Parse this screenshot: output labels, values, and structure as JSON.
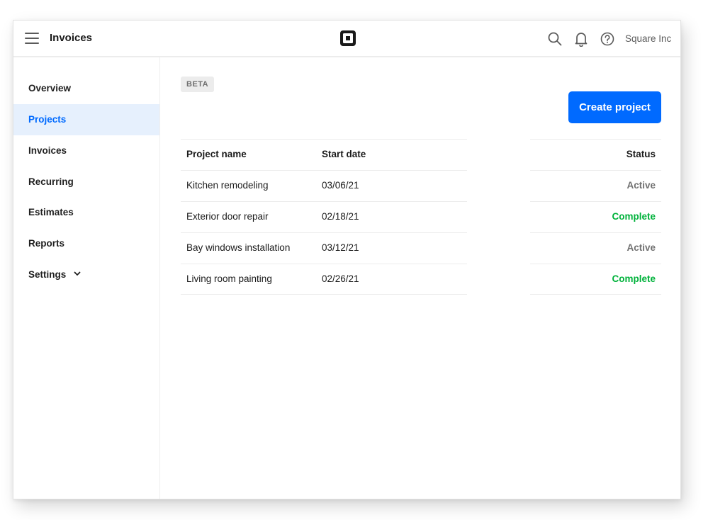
{
  "header": {
    "title": "Invoices",
    "account_name": "Square Inc",
    "icons": [
      "menu-icon",
      "square-logo-icon",
      "search-icon",
      "bell-icon",
      "help-icon"
    ]
  },
  "sidebar": {
    "items": [
      {
        "label": "Overview",
        "active": false
      },
      {
        "label": "Projects",
        "active": true
      },
      {
        "label": "Invoices",
        "active": false
      },
      {
        "label": "Recurring",
        "active": false
      },
      {
        "label": "Estimates",
        "active": false
      },
      {
        "label": "Reports",
        "active": false
      },
      {
        "label": "Settings",
        "active": false,
        "has_dropdown": true
      }
    ]
  },
  "main": {
    "badge": "BETA",
    "create_button": "Create project",
    "table": {
      "columns": [
        "Project name",
        "Start date",
        "Status"
      ],
      "rows": [
        {
          "name": "Kitchen remodeling",
          "start_date": "03/06/21",
          "status": "Active"
        },
        {
          "name": "Exterior door repair",
          "start_date": "02/18/21",
          "status": "Complete"
        },
        {
          "name": "Bay windows installation",
          "start_date": "03/12/21",
          "status": "Active"
        },
        {
          "name": "Living room painting",
          "start_date": "02/26/21",
          "status": "Complete"
        }
      ]
    }
  },
  "colors": {
    "accent": "#006aff",
    "active_nav_bg": "#e6f0fd",
    "status_active": "#717171",
    "status_complete": "#00b23b"
  }
}
